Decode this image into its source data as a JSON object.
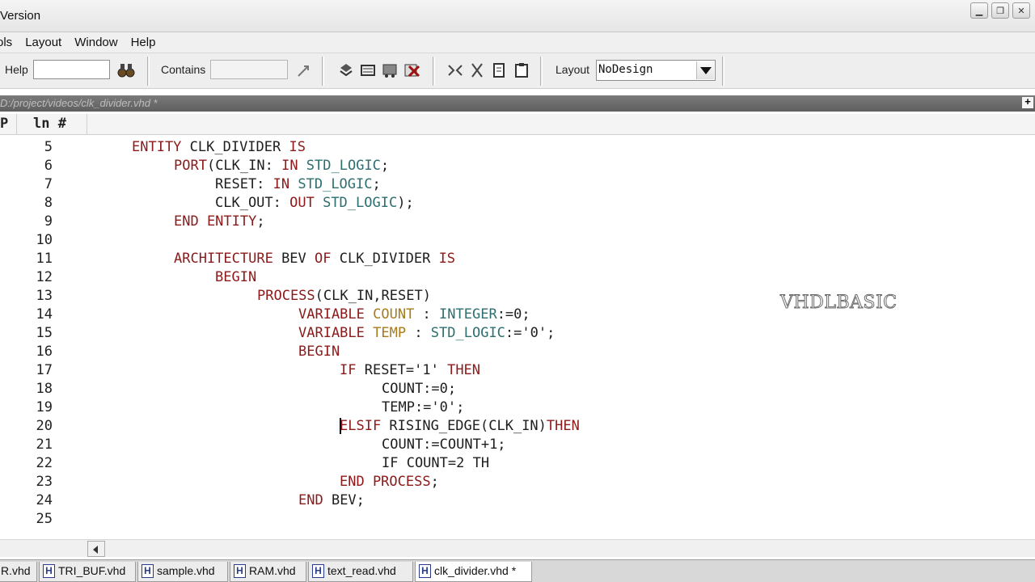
{
  "window": {
    "title": "Version"
  },
  "menu": [
    "ols",
    "Layout",
    "Window",
    "Help"
  ],
  "toolbar": {
    "help_label": "Help",
    "help_value": "",
    "contains_label": "Contains",
    "contains_value": "",
    "layout_label": "Layout",
    "layout_value": "NoDesign",
    "icons": [
      "binoculars-icon",
      "find-arrow-icon",
      "compile-icon",
      "compile-all-icon",
      "simulate-icon",
      "break-icon",
      "cut-marker-icon",
      "cut-icon",
      "copy-icon",
      "paste-icon"
    ]
  },
  "file": {
    "path": "D:/project/videos/clk_divider.vhd *"
  },
  "columns": {
    "p": "P",
    "ln": "ln #"
  },
  "code": [
    {
      "n": "5",
      "indent": 0,
      "tokens": [
        [
          "ENTITY ",
          "kw"
        ],
        [
          "CLK_DIVIDER ",
          "id"
        ],
        [
          "IS",
          "kw"
        ]
      ]
    },
    {
      "n": "6",
      "indent": 1,
      "tokens": [
        [
          "PORT",
          "kw"
        ],
        [
          "(CLK_IN: ",
          "id"
        ],
        [
          "IN ",
          "kw"
        ],
        [
          "STD_LOGIC",
          "ty"
        ],
        [
          ";",
          "op"
        ]
      ]
    },
    {
      "n": "7",
      "indent": 2,
      "tokens": [
        [
          "RESET: ",
          "id"
        ],
        [
          "IN ",
          "kw"
        ],
        [
          "STD_LOGIC",
          "ty"
        ],
        [
          ";",
          "op"
        ]
      ]
    },
    {
      "n": "8",
      "indent": 2,
      "tokens": [
        [
          "CLK_OUT: ",
          "id"
        ],
        [
          "OUT ",
          "kw"
        ],
        [
          "STD_LOGIC",
          "ty"
        ],
        [
          ");",
          "op"
        ]
      ]
    },
    {
      "n": "9",
      "indent": 1,
      "tokens": [
        [
          "END ENTITY",
          "kw"
        ],
        [
          ";",
          "op"
        ]
      ]
    },
    {
      "n": "10",
      "indent": 0,
      "tokens": []
    },
    {
      "n": "11",
      "indent": 1,
      "tokens": [
        [
          "ARCHITECTURE ",
          "kw"
        ],
        [
          "BEV ",
          "id"
        ],
        [
          "OF ",
          "kw"
        ],
        [
          "CLK_DIVIDER ",
          "id"
        ],
        [
          "IS",
          "kw"
        ]
      ]
    },
    {
      "n": "12",
      "indent": 2,
      "tokens": [
        [
          "BEGIN",
          "kw"
        ]
      ]
    },
    {
      "n": "13",
      "indent": 3,
      "tokens": [
        [
          "PROCESS",
          "kw"
        ],
        [
          "(CLK_IN,RESET)",
          "id"
        ]
      ]
    },
    {
      "n": "14",
      "indent": 4,
      "tokens": [
        [
          "VARIABLE ",
          "kw"
        ],
        [
          "COUNT ",
          "hl"
        ],
        [
          ": ",
          "op"
        ],
        [
          "INTEGER",
          "ty"
        ],
        [
          ":=0;",
          "op"
        ]
      ]
    },
    {
      "n": "15",
      "indent": 4,
      "tokens": [
        [
          "VARIABLE ",
          "kw"
        ],
        [
          "TEMP ",
          "hl"
        ],
        [
          ": ",
          "op"
        ],
        [
          "STD_LOGIC",
          "ty"
        ],
        [
          ":='0';",
          "op"
        ]
      ]
    },
    {
      "n": "16",
      "indent": 4,
      "tokens": [
        [
          "BEGIN",
          "kw"
        ]
      ]
    },
    {
      "n": "17",
      "indent": 5,
      "tokens": [
        [
          "IF ",
          "kw"
        ],
        [
          "RESET='1' ",
          "id"
        ],
        [
          "THEN",
          "kw"
        ]
      ]
    },
    {
      "n": "18",
      "indent": 6,
      "tokens": [
        [
          "COUNT:=0;",
          "id"
        ]
      ]
    },
    {
      "n": "19",
      "indent": 6,
      "tokens": [
        [
          "TEMP:='0';",
          "id"
        ]
      ]
    },
    {
      "n": "20",
      "indent": 5,
      "cursor": true,
      "tokens": [
        [
          "ELSIF ",
          "kw"
        ],
        [
          "RISING_EDGE",
          "id"
        ],
        [
          "(CLK_IN)",
          "id"
        ],
        [
          "THEN",
          "kw"
        ]
      ]
    },
    {
      "n": "21",
      "indent": 6,
      "tokens": [
        [
          "COUNT:=COUNT",
          "id"
        ],
        [
          "+1;",
          "op"
        ]
      ]
    },
    {
      "n": "22",
      "indent": 6,
      "tokens": [
        [
          "IF COUNT=2 TH",
          "id"
        ]
      ]
    },
    {
      "n": "23",
      "indent": 5,
      "tokens": [
        [
          "END PROCESS",
          "kw"
        ],
        [
          ";",
          "op"
        ]
      ]
    },
    {
      "n": "24",
      "indent": 4,
      "tokens": [
        [
          "END ",
          "kw"
        ],
        [
          "BEV;",
          "id"
        ]
      ]
    },
    {
      "n": "25",
      "indent": 0,
      "tokens": []
    }
  ],
  "watermark": "VHDLBASIC",
  "tabs": [
    {
      "label": "R.vhd",
      "icon": false,
      "active": false
    },
    {
      "label": "TRI_BUF.vhd",
      "icon": true,
      "active": false
    },
    {
      "label": "sample.vhd",
      "icon": true,
      "active": false
    },
    {
      "label": "RAM.vhd",
      "icon": true,
      "active": false
    },
    {
      "label": "text_read.vhd",
      "icon": true,
      "active": false
    },
    {
      "label": "clk_divider.vhd *",
      "icon": true,
      "active": true
    }
  ]
}
